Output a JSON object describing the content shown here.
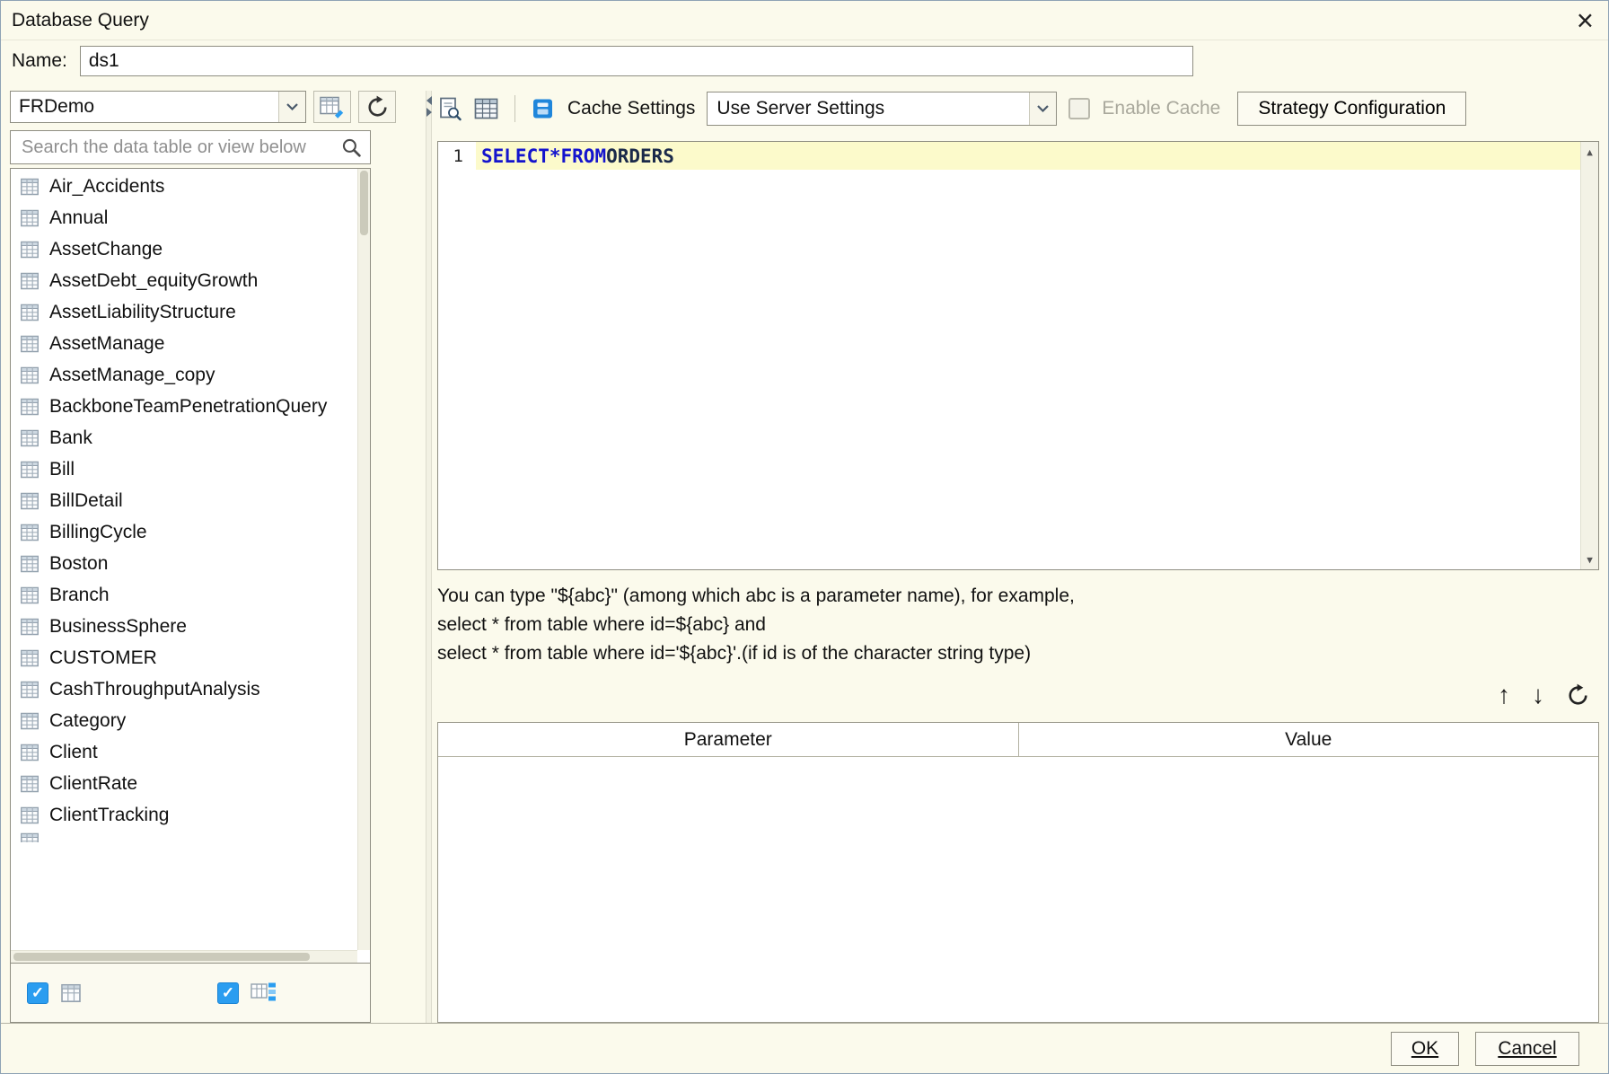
{
  "colors": {
    "accent_blue": "#2b9df0",
    "keyword_blue": "#1414cd",
    "line_highlight": "#fcfacb",
    "dialog_bg": "#fbfaec"
  },
  "dialog": {
    "title": "Database Query",
    "close_glyph": "×"
  },
  "name_field": {
    "label": "Name:",
    "value": "ds1"
  },
  "left_panel": {
    "connection": {
      "selected": "FRDemo"
    },
    "search": {
      "placeholder": "Search the data table or view below"
    },
    "tables": [
      "Air_Accidents",
      "Annual",
      "AssetChange",
      "AssetDebt_equityGrowth",
      "AssetLiabilityStructure",
      "AssetManage",
      "AssetManage_copy",
      "BackboneTeamPenetrationQuery",
      "Bank",
      "Bill",
      "BillDetail",
      "BillingCycle",
      "Boston",
      "Branch",
      "BusinessSphere",
      "CUSTOMER",
      "CashThroughputAnalysis",
      "Category",
      "Client",
      "ClientRate",
      "ClientTracking"
    ],
    "filters": {
      "show_tables_checked": true,
      "show_views_checked": true
    }
  },
  "toolbar": {
    "cache_settings_label": "Cache Settings",
    "cache_mode_selected": "Use Server Settings",
    "enable_cache_label": "Enable Cache",
    "enable_cache_checked": false,
    "strategy_button_label": "Strategy Configuration"
  },
  "sql_editor": {
    "line_number": "1",
    "tokens": {
      "kw1": "SELECT",
      "op": "*",
      "kw2": "FROM",
      "ident": "ORDERS"
    }
  },
  "help": {
    "line1": "You can type \"${abc}\" (among which abc is a parameter name), for example,",
    "line2": "select * from table where id=${abc} and",
    "line3": "select * from table where id='${abc}'.(if id is of the character string type)"
  },
  "param_table": {
    "columns": [
      "Parameter",
      "Value"
    ],
    "rows": []
  },
  "footer": {
    "ok": "OK",
    "cancel": "Cancel"
  },
  "icons": {
    "check": "✓",
    "up": "↑",
    "down": "↓",
    "scroll_up": "▲",
    "scroll_down": "▼"
  }
}
